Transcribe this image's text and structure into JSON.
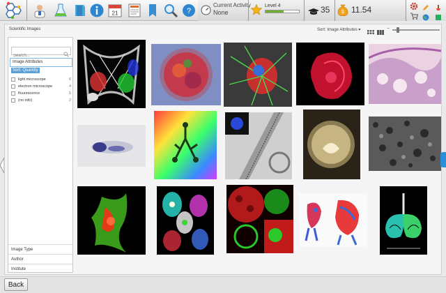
{
  "toolbar": {
    "icons": [
      "logo-molecule-icon",
      "profile-icon",
      "lab-flask-icon",
      "notebook-icon",
      "info-icon",
      "calendar-icon",
      "data-icon",
      "bookmark-icon",
      "search-icon",
      "help-icon"
    ],
    "calendar_day": "21"
  },
  "status": {
    "activity_label": "Current Activity",
    "activity_value": "None",
    "level_label": "Level 4",
    "level_progress": 0.55,
    "stat_one": "35",
    "stat_two": "11.54"
  },
  "header": {
    "breadcrumb": "Scientific Images",
    "sort_label": "Sort: Image Attributes ▾"
  },
  "filter": {
    "search_placeholder": "Search...",
    "section_title": "Image Attributes",
    "sort_badge": "Sort: Quantity",
    "options": [
      {
        "label": "light microscope",
        "count": "6"
      },
      {
        "label": "electron microscope",
        "count": "4"
      },
      {
        "label": "flourescence",
        "count": "5"
      },
      {
        "label": "(no info)",
        "count": "2"
      }
    ],
    "categories": [
      "Image Type",
      "Author",
      "Institute"
    ]
  },
  "gallery": {
    "images": [
      {
        "name": "fluorescent-neuron-mesh"
      },
      {
        "name": "fluorescent-spheroid"
      },
      {
        "name": "green-filament-cell"
      },
      {
        "name": "red-heart-tissue"
      },
      {
        "name": "pink-stained-tissue"
      },
      {
        "name": "blue-stained-embryo"
      },
      {
        "name": "rainbow-branching-gland"
      },
      {
        "name": "em-muscle-fiber"
      },
      {
        "name": "larva-in-egg"
      },
      {
        "name": "em-porous-surface"
      },
      {
        "name": "green-red-cell-cluster"
      },
      {
        "name": "fluorescent-cell-quartet"
      },
      {
        "name": "red-green-tissue-section"
      },
      {
        "name": "stained-embryo-skeletons"
      },
      {
        "name": "lung-branching-organoid"
      }
    ]
  },
  "footer": {
    "back_label": "Back"
  }
}
